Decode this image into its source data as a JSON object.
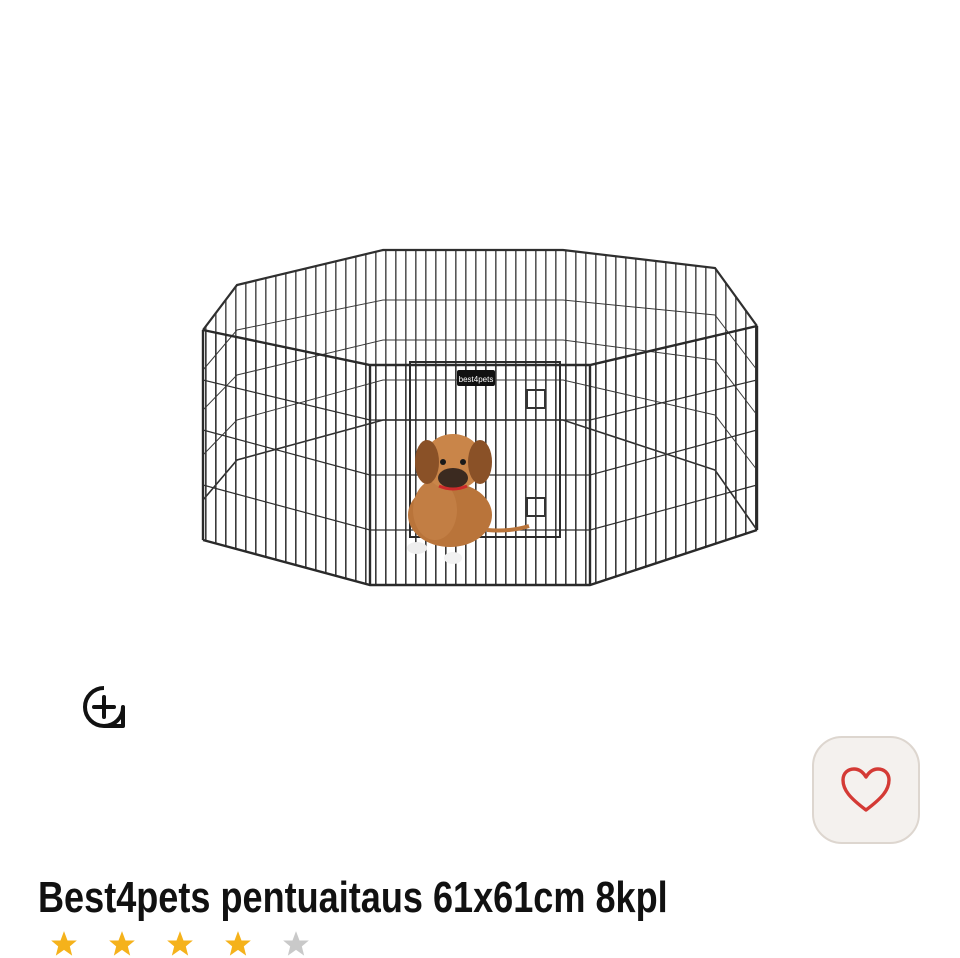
{
  "product": {
    "title": "Best4pets pentuaitaus 61x61cm 8kpl",
    "image_icon": "playpen-with-puppy-image",
    "brand_tag_text": "best4pets"
  },
  "controls": {
    "zoom_icon": "zoom-in-icon",
    "wishlist_icon": "heart-icon"
  },
  "rating": {
    "stars_visible": 5,
    "star_colors": [
      "#f5b21b",
      "#f5b21b",
      "#f5b21b",
      "#f5b21b",
      "#c9c9c9"
    ]
  },
  "colors": {
    "title": "#111111",
    "heart": "#d43a35",
    "wishlist_bg": "#f4f1ee",
    "star": "#f5b21b"
  }
}
